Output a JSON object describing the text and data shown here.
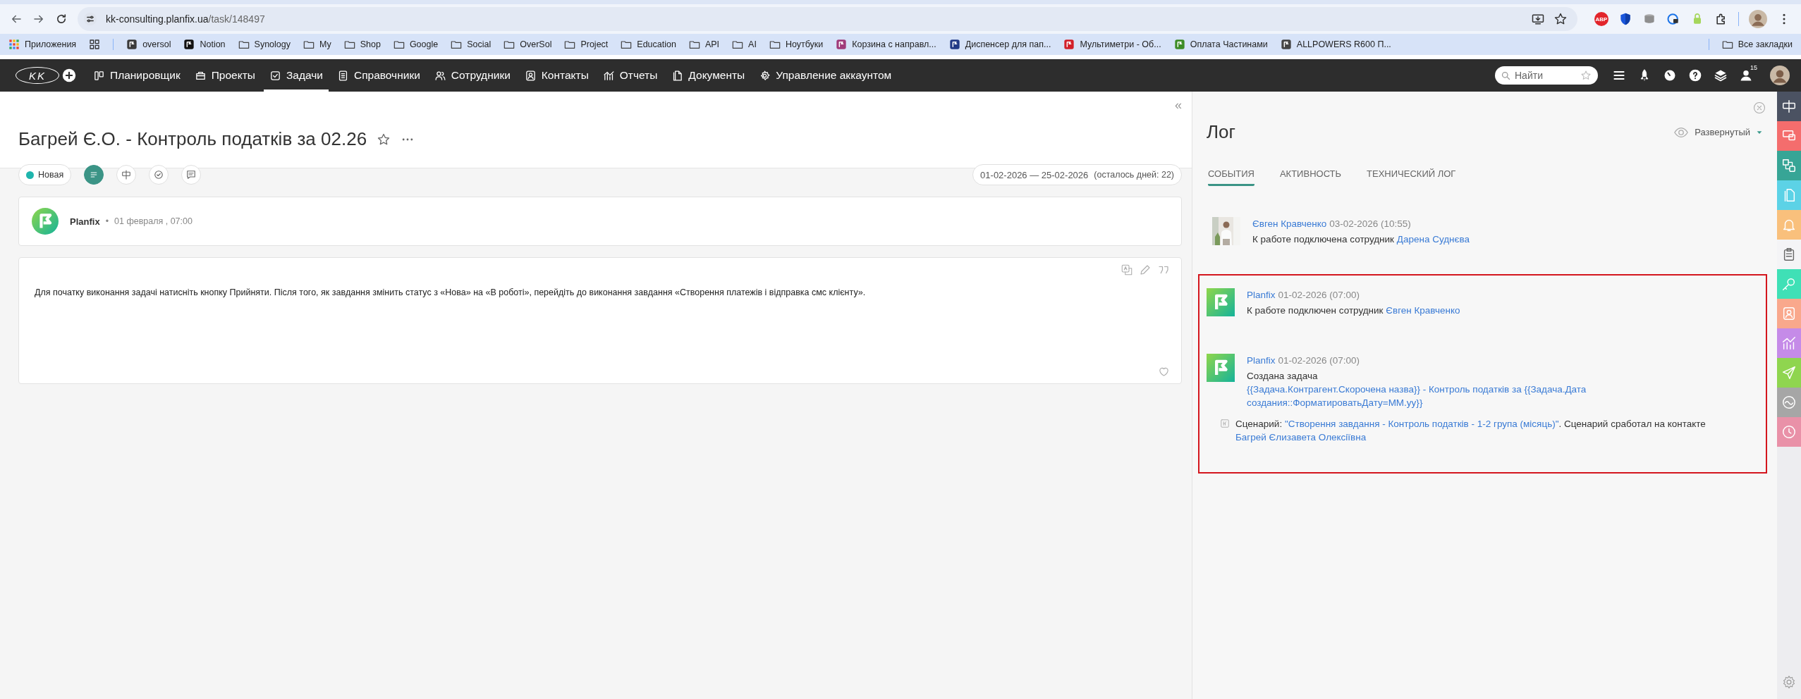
{
  "browser": {
    "url_host": "kk-consulting.planfix.ua",
    "url_path": "/task/148497",
    "extension_badge": "ABP",
    "bookmarks": [
      {
        "label": "Приложения",
        "kind": "apps"
      },
      {
        "kind": "grid"
      },
      {
        "label": "oversol",
        "kind": "site"
      },
      {
        "label": "Notion",
        "kind": "site"
      },
      {
        "label": "Synology",
        "kind": "folder"
      },
      {
        "label": "My",
        "kind": "folder"
      },
      {
        "label": "Shop",
        "kind": "folder"
      },
      {
        "label": "Google",
        "kind": "folder"
      },
      {
        "label": "Social",
        "kind": "folder"
      },
      {
        "label": "OverSol",
        "kind": "folder"
      },
      {
        "label": "Project",
        "kind": "folder"
      },
      {
        "label": "Education",
        "kind": "folder"
      },
      {
        "label": "API",
        "kind": "folder"
      },
      {
        "label": "AI",
        "kind": "folder"
      },
      {
        "label": "Ноутбуки",
        "kind": "folder"
      },
      {
        "label": "Корзина с направл...",
        "kind": "site"
      },
      {
        "label": "Диспенсер для пап...",
        "kind": "site"
      },
      {
        "label": "Мультиметри - Об...",
        "kind": "site"
      },
      {
        "label": "Оплата Частинами",
        "kind": "site"
      },
      {
        "label": "ALLPOWERS R600 П...",
        "kind": "site"
      }
    ],
    "all_bookmarks": "Все закладки"
  },
  "app_nav": {
    "logo": "KK",
    "items": [
      {
        "label": "Планировщик",
        "selected": false
      },
      {
        "label": "Проекты",
        "selected": false
      },
      {
        "label": "Задачи",
        "selected": true
      },
      {
        "label": "Справочники",
        "selected": false
      },
      {
        "label": "Сотрудники",
        "selected": false
      },
      {
        "label": "Контакты",
        "selected": false
      },
      {
        "label": "Отчеты",
        "selected": false
      },
      {
        "label": "Документы",
        "selected": false
      },
      {
        "label": "Управление аккаунтом",
        "selected": false
      }
    ],
    "search": {
      "placeholder": "Найти"
    },
    "notifications_count": "15"
  },
  "task": {
    "collapse": "«",
    "title": "Багрей Є.О. - Контроль податків за 02.26",
    "status": {
      "label": "Новая",
      "color": "#1fb5ad"
    },
    "view_buttons": [
      {
        "selected": true
      },
      {
        "selected": false
      },
      {
        "selected": false
      },
      {
        "selected": false
      }
    ],
    "dates": "01-02-2026 — 25-02-2026",
    "days_left": "(осталось дней: 22)",
    "header_card": {
      "author": "Planfix",
      "separator": "•",
      "time": "01 февраля , 07:00"
    },
    "description": "Для початку виконання задачі натисніть кнопку Прийняти. Після того, як завдання змінить статус з «Нова» на «В роботі», перейдіть до виконання завдання «Створення платежів і відправка смс клієнту»."
  },
  "log": {
    "title": "Лог",
    "mode": "Развернутый",
    "tabs": [
      {
        "label": "СОБЫТИЯ",
        "selected": true
      },
      {
        "label": "АКТИВНОСТЬ",
        "selected": false
      },
      {
        "label": "ТЕХНИЧЕСКИЙ ЛОГ",
        "selected": false
      }
    ],
    "entries": [
      {
        "highlighted": false,
        "author": "Євген Кравченко",
        "time": "03-02-2026 (10:55)",
        "text": [
          {
            "t": "К работе подключена сотрудник "
          },
          {
            "t": "Дарена Суднєва",
            "link": true
          }
        ]
      },
      {
        "kind": "system",
        "highlighted": true,
        "author": "Planfix",
        "time": "01-02-2026 (07:00)",
        "text": [
          {
            "t": "К работе подключен сотрудник "
          },
          {
            "t": "Євген Кравченко",
            "link": true
          }
        ]
      },
      {
        "kind": "system",
        "highlighted": true,
        "author": "Planfix",
        "time": "01-02-2026 (07:00)",
        "text": [
          {
            "t": "Создана задача "
          },
          {
            "t": "{{Задача.Контрагент.Скорочена назва}} - Контроль податків за {{Задача.Дата создания::ФорматироватьДату=MM.yy}}",
            "link": true
          }
        ],
        "note": [
          {
            "t": "Сценарий: "
          },
          {
            "t": "\"Створення завдання - Контроль податків - 1-2 група (місяць)\"",
            "link": true
          },
          {
            "t": ". Сценарий сработал на контакте "
          },
          {
            "t": "Багрей Єлизавета Олексіївна",
            "link": true
          }
        ]
      }
    ]
  },
  "side_tabs": [
    {
      "kind": "board",
      "color": "#4b5262"
    },
    {
      "kind": "monitor",
      "color": "#f46d6d"
    },
    {
      "kind": "shapes",
      "color": "#37a596"
    },
    {
      "kind": "document",
      "color": "#5cd2e6"
    },
    {
      "kind": "bell",
      "color": "#f9c07c"
    },
    {
      "kind": "clipboard",
      "color": "#f4f4f6"
    },
    {
      "kind": "key",
      "color": "#3fe0b6"
    },
    {
      "kind": "contact",
      "color": "#f9a88c"
    },
    {
      "kind": "chart",
      "color": "#c58be8"
    },
    {
      "kind": "send",
      "color": "#8fd54f"
    },
    {
      "kind": "wave",
      "color": "#a6a6a6"
    },
    {
      "kind": "clock",
      "color": "#e991a8"
    }
  ]
}
